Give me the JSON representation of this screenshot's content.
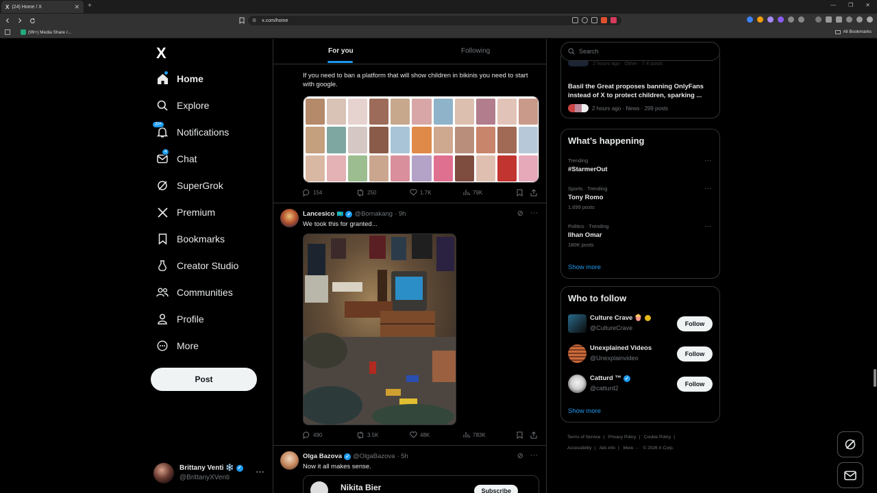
{
  "browser": {
    "tab_title": "(24) Home / X",
    "tab_favicon": "X",
    "url": "x.com/home",
    "bookmark": "(99+) Media Share /...",
    "all_bookmarks": "All Bookmarks"
  },
  "sidebar": {
    "logo": "X",
    "items": [
      {
        "label": "Home",
        "icon": "home-icon"
      },
      {
        "label": "Explore",
        "icon": "search-icon"
      },
      {
        "label": "Notifications",
        "icon": "bell-icon",
        "badge": "20+"
      },
      {
        "label": "Chat",
        "icon": "mail-icon",
        "badge": "4"
      },
      {
        "label": "SuperGrok",
        "icon": "grok-icon"
      },
      {
        "label": "Premium",
        "icon": "x-icon"
      },
      {
        "label": "Bookmarks",
        "icon": "bookmark-icon"
      },
      {
        "label": "Creator Studio",
        "icon": "creator-studio-icon"
      },
      {
        "label": "Communities",
        "icon": "communities-icon"
      },
      {
        "label": "Profile",
        "icon": "person-icon"
      },
      {
        "label": "More",
        "icon": "more-circle-icon"
      }
    ],
    "post_button": "Post",
    "account": {
      "name": "Brittany Venti ❄️",
      "handle": "@BrittanyXVenti"
    }
  },
  "feed": {
    "tabs": [
      "For you",
      "Following"
    ],
    "posts": [
      {
        "text": "If you need to ban a platform that will show children in bikinis you need to start with google.",
        "replies": "154",
        "reposts": "250",
        "likes": "1.7K",
        "views": "79K"
      },
      {
        "name": "Lancesico",
        "flag": "🇰🇿",
        "handle": "@Bornakang",
        "time": "· 9h",
        "text": "We took this for granted...",
        "replies": "490",
        "reposts": "3.5K",
        "likes": "48K",
        "views": "783K"
      },
      {
        "name": "Olga Bazova",
        "handle": "@OlgaBazova",
        "time": "· 5h",
        "text": "Now it all makes sense.",
        "quote": {
          "name": "Nikita Bier",
          "button": "Subscribe"
        }
      }
    ]
  },
  "right": {
    "search_placeholder": "Search",
    "news": {
      "partial_meta": "2 hours ago · Other · 7.4 posts",
      "title": "Basil the Great proposes banning OnlyFans instead of X to protect children, sparking ...",
      "meta": "2 hours ago · News · 299 posts"
    },
    "happening": {
      "title": "What’s happening",
      "trends": [
        {
          "meta": "Trending",
          "name": "#StarmerOut",
          "count": ""
        },
        {
          "meta": "Sports · Trending",
          "name": "Tony Romo",
          "count": "1,699 posts"
        },
        {
          "meta": "Politics · Trending",
          "name": "Ilhan Omar",
          "count": "180K posts"
        }
      ],
      "show_more": "Show more"
    },
    "who_to_follow": {
      "title": "Who to follow",
      "accounts": [
        {
          "name": "Culture Crave 🍿",
          "handle": "@CultureCrave",
          "button": "Follow"
        },
        {
          "name": "Unexplained Videos",
          "handle": "@Unexplainvideo",
          "button": "Follow"
        },
        {
          "name": "Catturd ™",
          "handle": "@catturd2",
          "button": "Follow"
        }
      ],
      "show_more": "Show more"
    },
    "footer": [
      "Terms of Service",
      "Privacy Policy",
      "Cookie Policy",
      "Accessibility",
      "Ads info",
      "More ···",
      "© 2026 X Corp."
    ]
  },
  "colors": {
    "accent": "#1d9bf0",
    "background": "#000000",
    "text": "#e7e9ea",
    "muted": "#71767b"
  }
}
